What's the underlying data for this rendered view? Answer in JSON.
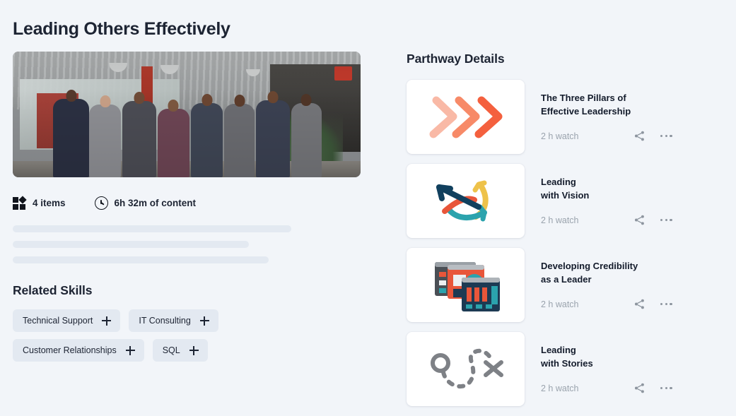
{
  "page": {
    "title": "Leading Others Effectively",
    "background_color": "#f2f5f9"
  },
  "hero": {
    "alt": "group-photo-office-team"
  },
  "meta": {
    "items_icon": "grid-items-icon",
    "items_text": "4 items",
    "clock_icon": "clock-icon",
    "duration_text": "6h 32m of content"
  },
  "skeleton": {
    "bars": [
      410,
      350,
      378
    ]
  },
  "related_skills": {
    "heading": "Related Skills",
    "chips": [
      {
        "label": "Technical Support",
        "add_icon": "plus-icon"
      },
      {
        "label": "IT Consulting",
        "add_icon": "plus-icon"
      },
      {
        "label": "Customer Relationships",
        "add_icon": "plus-icon"
      },
      {
        "label": "SQL",
        "add_icon": "plus-icon"
      }
    ]
  },
  "pathway": {
    "heading": "Parthway Details",
    "cards": [
      {
        "title": "The Three Pillars of\nEffective Leadership",
        "duration": "2 h watch",
        "thumb_icon": "three-chevrons-icon",
        "share_icon": "share-icon",
        "more_icon": "more-options-icon"
      },
      {
        "title": "Leading\nwith Vision",
        "duration": "2 h watch",
        "thumb_icon": "crossing-arrows-icon",
        "share_icon": "share-icon",
        "more_icon": "more-options-icon"
      },
      {
        "title": "Developing Credibility\nas a Leader",
        "duration": "2 h watch",
        "thumb_icon": "stacked-dashboard-windows-icon",
        "share_icon": "share-icon",
        "more_icon": "more-options-icon"
      },
      {
        "title": "Leading\nwith Stories",
        "duration": "2 h watch",
        "thumb_icon": "treasure-map-path-icon",
        "share_icon": "share-icon",
        "more_icon": "more-options-icon"
      }
    ]
  },
  "colors": {
    "text_primary": "#1d2433",
    "text_muted": "#9aa3ad",
    "chip_bg": "#e3e9f1",
    "skeleton": "#e3e9f1",
    "card_bg": "#ffffff",
    "accent_coral": "#f4603e",
    "accent_navy": "#11405e",
    "accent_teal": "#2ba3ad",
    "accent_yellow": "#eec24a",
    "accent_gray": "#7e8186"
  }
}
